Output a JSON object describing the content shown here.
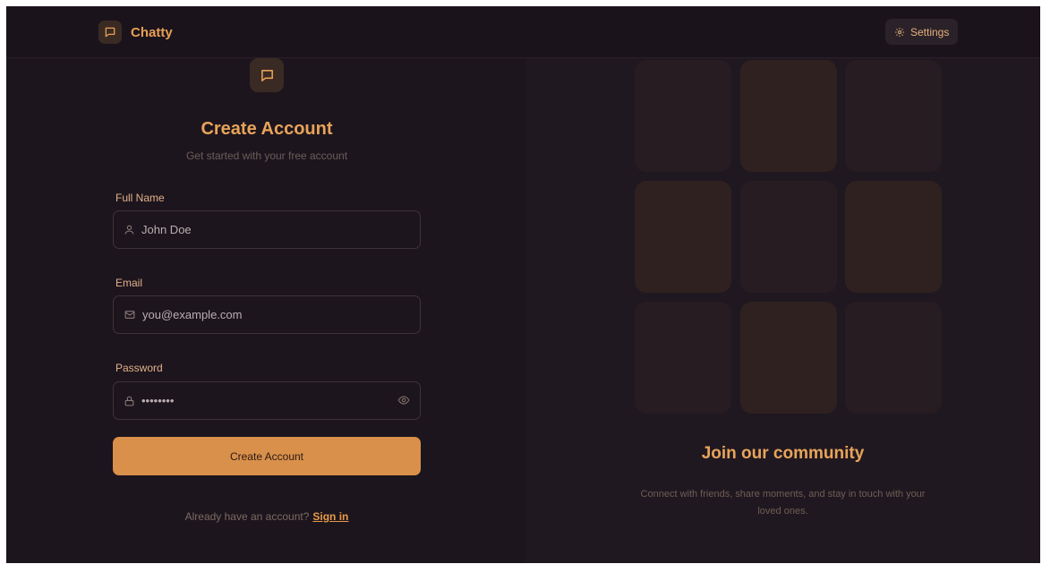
{
  "navbar": {
    "brand_name": "Chatty",
    "settings_label": "Settings"
  },
  "form": {
    "title": "Create Account",
    "subtitle": "Get started with your free account",
    "fields": {
      "full_name": {
        "label": "Full Name",
        "placeholder": "John Doe",
        "icon": "user-icon"
      },
      "email": {
        "label": "Email",
        "placeholder": "you@example.com",
        "icon": "mail-icon"
      },
      "password": {
        "label": "Password",
        "value": "••••••••",
        "icon": "lock-icon",
        "toggle_icon": "eye-icon"
      }
    },
    "submit_label": "Create Account",
    "signin_prompt": "Already have an account?",
    "signin_link": "Sign in"
  },
  "community": {
    "title": "Join our community",
    "text": "Connect with friends, share moments, and stay in touch with your loved ones."
  },
  "colors": {
    "accent": "#d9904a",
    "heading": "#e7a45a",
    "background": "#1d151d",
    "tile_light": "#2e211f",
    "tile_dark": "#261c21"
  }
}
